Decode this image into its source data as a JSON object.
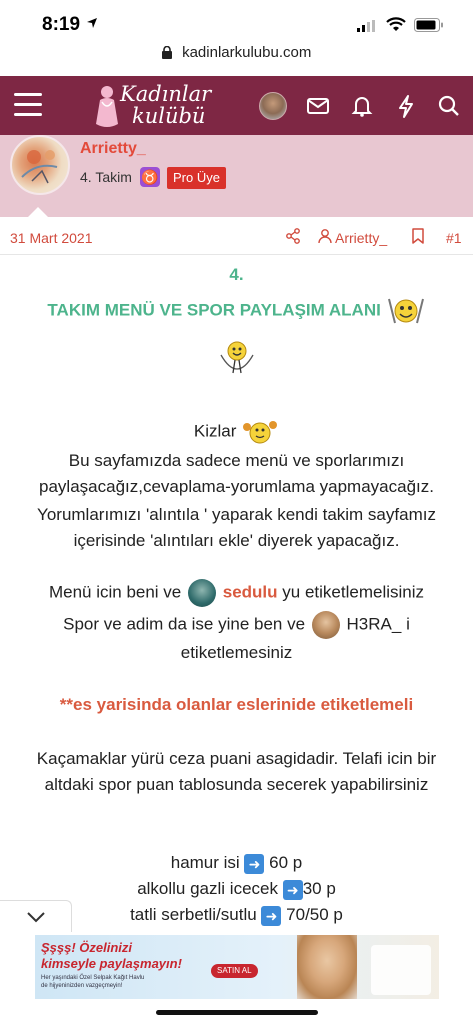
{
  "status_bar": {
    "time": "8:19"
  },
  "browser": {
    "url": "kadinlarkulubu.com"
  },
  "header": {
    "logo_line1": "Kadınlar",
    "logo_line2": "kulübü",
    "brand_color": "#7e2744"
  },
  "author": {
    "name": "Arrietty_",
    "rank": "4. Takim",
    "zodiac_symbol": "♉",
    "badge": "Pro Üye"
  },
  "post_meta": {
    "date": "31 Mart 2021",
    "username": "Arrietty_",
    "post_number": "#1"
  },
  "post": {
    "heading_number": "4.",
    "heading_title": "TAKIM MENÜ VE SPOR PAYLAŞIM ALANI",
    "greeting": "Kizlar",
    "para1_line1": "Bu sayfamızda sadece menü ve sporlarımızı",
    "para1_line2": "paylaşacağız,cevaplama-yorumlama yapmayacağız.",
    "para1_line3": "Yorumlarımızı 'alıntıla ' yaparak kendi takim sayfamız",
    "para1_line4": "içerisinde 'alıntıları ekle' diyerek yapacağız.",
    "menu_prefix": "Menü icin beni ve",
    "menu_mention": "sedulu",
    "menu_suffix": "yu etiketlemelisiniz",
    "sport_prefix": "Spor ve adim da ise yine ben ve",
    "sport_mention": "H3RA_",
    "sport_suffix": "i",
    "sport_line2": "etiketlemesiniz",
    "highlight": "**es yarisinda olanlar eslerinide etiketlemeli",
    "para2_line1": "Kaçamaklar yürü ceza puani asagidadir. Telafi icin bir",
    "para2_line2": "altdaki spor puan tablosunda secerek yapabilirsiniz",
    "penalties": [
      {
        "item": "hamur isi",
        "points": "60 p"
      },
      {
        "item": "alkollu gazli icecek",
        "points": "30 p"
      },
      {
        "item": "tatli serbetli/sutlu",
        "points": "70/50 p"
      }
    ]
  },
  "ad": {
    "headline1": "Şşşş! Özelinizi",
    "headline2": "kimseyle paylaşmayın!",
    "cta": "SATIN AL",
    "small1": "Her yaşındaki Özel Selpak Kağıt Havlu",
    "small2": "de hijyeninizden vazgeçmeyin!"
  }
}
